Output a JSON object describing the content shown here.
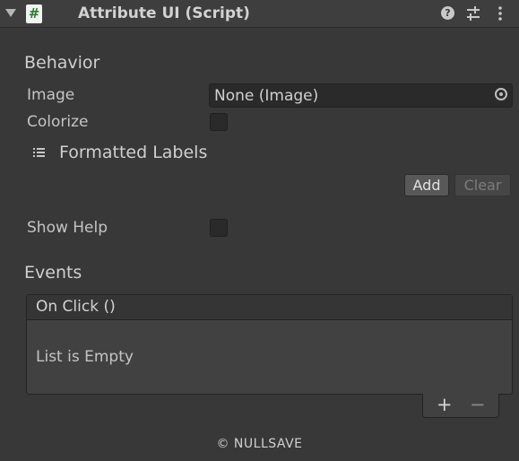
{
  "header": {
    "title": "Attribute UI (Script)",
    "script_icon_glyph": "#",
    "help_glyph": "?"
  },
  "behavior": {
    "section_title": "Behavior",
    "image_label": "Image",
    "image_value": "None (Image)",
    "colorize_label": "Colorize",
    "colorize_checked": false,
    "formatted_labels_title": "Formatted Labels",
    "add_label": "Add",
    "clear_label": "Clear",
    "show_help_label": "Show Help",
    "show_help_checked": false
  },
  "events": {
    "section_title": "Events",
    "on_click_label": "On Click ()",
    "empty_text": "List is Empty",
    "plus_glyph": "+",
    "minus_glyph": "−"
  },
  "footer": {
    "copyright": "© NULLSAVE"
  },
  "icons": {
    "foldout": "foldout-arrow-icon",
    "script": "script-icon",
    "help": "help-icon",
    "presets": "presets-icon",
    "menu": "kebab-menu-icon",
    "object_picker": "object-picker-icon",
    "list": "list-icon"
  },
  "colors": {
    "background": "#383838",
    "header": "#3e3e3e",
    "field": "#2a2a2a",
    "script_icon_green": "#2f7d2f"
  }
}
